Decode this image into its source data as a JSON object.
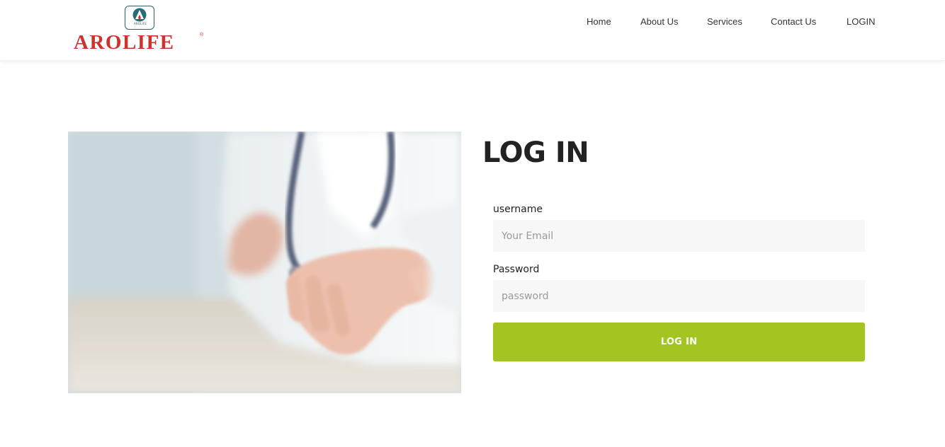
{
  "brand": {
    "name": "AROLIFE",
    "mark_text": "AROLIFE",
    "registered": "®",
    "color": "#d0312d",
    "mark_color": "#2b5f6b"
  },
  "nav": {
    "items": [
      {
        "label": "Home"
      },
      {
        "label": "About Us"
      },
      {
        "label": "Services"
      },
      {
        "label": "Contact Us"
      },
      {
        "label": "LOGIN"
      }
    ]
  },
  "hero_image": {
    "icon": "doctor-open-hand-photo"
  },
  "form": {
    "title": "LOG IN",
    "username_label": "username",
    "username_placeholder": "Your Email",
    "username_value": "",
    "password_label": "Password",
    "password_placeholder": "password",
    "password_value": "",
    "submit_label": "LOG IN",
    "submit_color": "#a4c421"
  }
}
